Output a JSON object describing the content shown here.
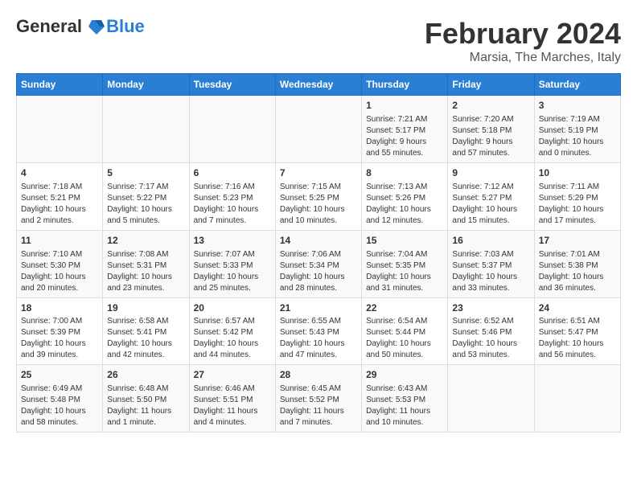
{
  "header": {
    "logo_line1": "General",
    "logo_line2": "Blue",
    "title": "February 2024",
    "subtitle": "Marsia, The Marches, Italy"
  },
  "weekdays": [
    "Sunday",
    "Monday",
    "Tuesday",
    "Wednesday",
    "Thursday",
    "Friday",
    "Saturday"
  ],
  "weeks": [
    [
      {
        "day": "",
        "info": ""
      },
      {
        "day": "",
        "info": ""
      },
      {
        "day": "",
        "info": ""
      },
      {
        "day": "",
        "info": ""
      },
      {
        "day": "1",
        "info": "Sunrise: 7:21 AM\nSunset: 5:17 PM\nDaylight: 9 hours\nand 55 minutes."
      },
      {
        "day": "2",
        "info": "Sunrise: 7:20 AM\nSunset: 5:18 PM\nDaylight: 9 hours\nand 57 minutes."
      },
      {
        "day": "3",
        "info": "Sunrise: 7:19 AM\nSunset: 5:19 PM\nDaylight: 10 hours\nand 0 minutes."
      }
    ],
    [
      {
        "day": "4",
        "info": "Sunrise: 7:18 AM\nSunset: 5:21 PM\nDaylight: 10 hours\nand 2 minutes."
      },
      {
        "day": "5",
        "info": "Sunrise: 7:17 AM\nSunset: 5:22 PM\nDaylight: 10 hours\nand 5 minutes."
      },
      {
        "day": "6",
        "info": "Sunrise: 7:16 AM\nSunset: 5:23 PM\nDaylight: 10 hours\nand 7 minutes."
      },
      {
        "day": "7",
        "info": "Sunrise: 7:15 AM\nSunset: 5:25 PM\nDaylight: 10 hours\nand 10 minutes."
      },
      {
        "day": "8",
        "info": "Sunrise: 7:13 AM\nSunset: 5:26 PM\nDaylight: 10 hours\nand 12 minutes."
      },
      {
        "day": "9",
        "info": "Sunrise: 7:12 AM\nSunset: 5:27 PM\nDaylight: 10 hours\nand 15 minutes."
      },
      {
        "day": "10",
        "info": "Sunrise: 7:11 AM\nSunset: 5:29 PM\nDaylight: 10 hours\nand 17 minutes."
      }
    ],
    [
      {
        "day": "11",
        "info": "Sunrise: 7:10 AM\nSunset: 5:30 PM\nDaylight: 10 hours\nand 20 minutes."
      },
      {
        "day": "12",
        "info": "Sunrise: 7:08 AM\nSunset: 5:31 PM\nDaylight: 10 hours\nand 23 minutes."
      },
      {
        "day": "13",
        "info": "Sunrise: 7:07 AM\nSunset: 5:33 PM\nDaylight: 10 hours\nand 25 minutes."
      },
      {
        "day": "14",
        "info": "Sunrise: 7:06 AM\nSunset: 5:34 PM\nDaylight: 10 hours\nand 28 minutes."
      },
      {
        "day": "15",
        "info": "Sunrise: 7:04 AM\nSunset: 5:35 PM\nDaylight: 10 hours\nand 31 minutes."
      },
      {
        "day": "16",
        "info": "Sunrise: 7:03 AM\nSunset: 5:37 PM\nDaylight: 10 hours\nand 33 minutes."
      },
      {
        "day": "17",
        "info": "Sunrise: 7:01 AM\nSunset: 5:38 PM\nDaylight: 10 hours\nand 36 minutes."
      }
    ],
    [
      {
        "day": "18",
        "info": "Sunrise: 7:00 AM\nSunset: 5:39 PM\nDaylight: 10 hours\nand 39 minutes."
      },
      {
        "day": "19",
        "info": "Sunrise: 6:58 AM\nSunset: 5:41 PM\nDaylight: 10 hours\nand 42 minutes."
      },
      {
        "day": "20",
        "info": "Sunrise: 6:57 AM\nSunset: 5:42 PM\nDaylight: 10 hours\nand 44 minutes."
      },
      {
        "day": "21",
        "info": "Sunrise: 6:55 AM\nSunset: 5:43 PM\nDaylight: 10 hours\nand 47 minutes."
      },
      {
        "day": "22",
        "info": "Sunrise: 6:54 AM\nSunset: 5:44 PM\nDaylight: 10 hours\nand 50 minutes."
      },
      {
        "day": "23",
        "info": "Sunrise: 6:52 AM\nSunset: 5:46 PM\nDaylight: 10 hours\nand 53 minutes."
      },
      {
        "day": "24",
        "info": "Sunrise: 6:51 AM\nSunset: 5:47 PM\nDaylight: 10 hours\nand 56 minutes."
      }
    ],
    [
      {
        "day": "25",
        "info": "Sunrise: 6:49 AM\nSunset: 5:48 PM\nDaylight: 10 hours\nand 58 minutes."
      },
      {
        "day": "26",
        "info": "Sunrise: 6:48 AM\nSunset: 5:50 PM\nDaylight: 11 hours\nand 1 minute."
      },
      {
        "day": "27",
        "info": "Sunrise: 6:46 AM\nSunset: 5:51 PM\nDaylight: 11 hours\nand 4 minutes."
      },
      {
        "day": "28",
        "info": "Sunrise: 6:45 AM\nSunset: 5:52 PM\nDaylight: 11 hours\nand 7 minutes."
      },
      {
        "day": "29",
        "info": "Sunrise: 6:43 AM\nSunset: 5:53 PM\nDaylight: 11 hours\nand 10 minutes."
      },
      {
        "day": "",
        "info": ""
      },
      {
        "day": "",
        "info": ""
      }
    ]
  ]
}
